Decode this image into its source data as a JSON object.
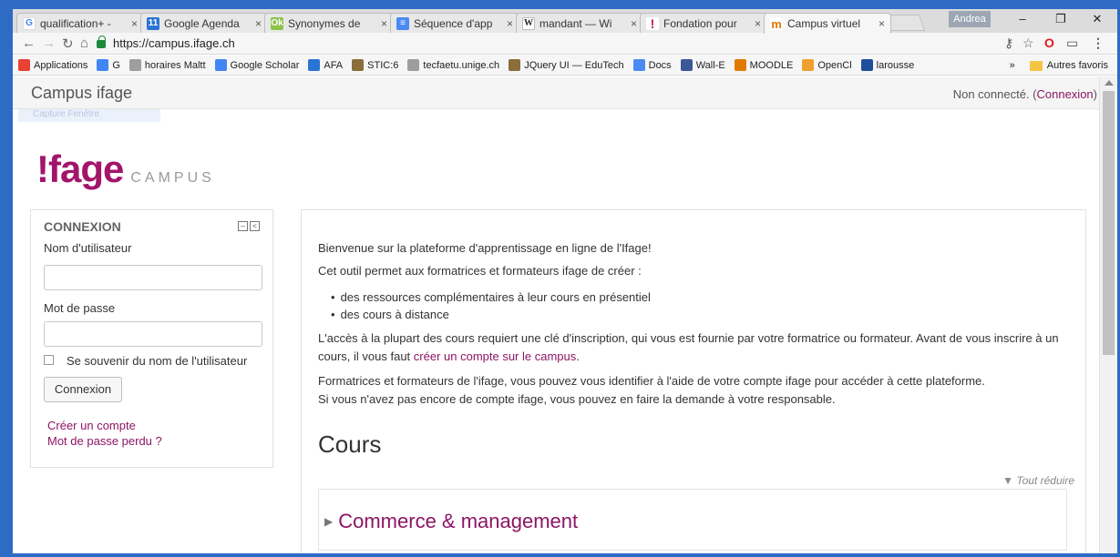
{
  "browser": {
    "tabs": [
      {
        "title": "qualification+ -",
        "fav": "G",
        "color": "#ffffff",
        "fg": "#4285f4"
      },
      {
        "title": "Google Agenda",
        "fav": "11",
        "color": "#2a74d5",
        "fg": "#ffffff"
      },
      {
        "title": "Synonymes de",
        "fav": "Ok",
        "color": "#8bc34a",
        "fg": "#ffffff"
      },
      {
        "title": "Séquence d'app",
        "fav": "≡",
        "color": "#4a8af4",
        "fg": "#ffffff"
      },
      {
        "title": "mandant — Wi",
        "fav": "W",
        "color": "#ffffff",
        "fg": "#222222"
      },
      {
        "title": "Fondation pour",
        "fav": "!",
        "color": "#ffffff",
        "fg": "#c2185b"
      },
      {
        "title": "Campus virtuel",
        "fav": "m",
        "color": "#ffffff",
        "fg": "#e07b00"
      }
    ],
    "profile": "Andrea",
    "url": "https://campus.ifage.ch",
    "bookmarks": [
      {
        "label": "Applications",
        "icon": "apps-icon",
        "color": "#e94235"
      },
      {
        "label": "G",
        "icon": "google-icon",
        "color": "#4285f4"
      },
      {
        "label": "horaires Maltt",
        "icon": "page-icon",
        "color": "#9e9e9e"
      },
      {
        "label": "Google Scholar",
        "icon": "scholar-icon",
        "color": "#4285f4"
      },
      {
        "label": "AFA",
        "icon": "calendar-icon",
        "color": "#2a74d5"
      },
      {
        "label": "STIC:6",
        "icon": "gnu-icon",
        "color": "#8a6d3b"
      },
      {
        "label": "tecfaetu.unige.ch",
        "icon": "page-icon",
        "color": "#9e9e9e"
      },
      {
        "label": "JQuery UI — EduTech",
        "icon": "gnu-icon",
        "color": "#8a6d3b"
      },
      {
        "label": "Docs",
        "icon": "docs-icon",
        "color": "#4a8af4"
      },
      {
        "label": "Wall-E",
        "icon": "facebook-icon",
        "color": "#3b5998"
      },
      {
        "label": "MOODLE",
        "icon": "moodle-icon",
        "color": "#e07b00"
      },
      {
        "label": "OpenCl",
        "icon": "opencl-icon",
        "color": "#f0a030"
      },
      {
        "label": "larousse",
        "icon": "larousse-icon",
        "color": "#1f4e9c"
      }
    ],
    "more_bookmarks": "»",
    "other_bookmarks": "Autres favoris"
  },
  "page": {
    "site_name": "Campus ifage",
    "ghost_tooltip": "Capture Fenêtre",
    "login_status": "Non connecté. (",
    "login_link": "Connexion",
    "login_status_end": ")",
    "logo_main": "!fage",
    "logo_sub": "CAMPUS",
    "login_block": {
      "title": "CONNEXION",
      "username_label": "Nom d'utilisateur",
      "password_label": "Mot de passe",
      "remember_label": "Se souvenir du nom de l'utilisateur",
      "submit": "Connexion",
      "create_account": "Créer un compte",
      "lost_password": "Mot de passe perdu ?"
    },
    "main": {
      "welcome": "Bienvenue sur la plateforme d'apprentissage en ligne de l'Ifage!",
      "intro": "Cet outil permet aux formatrices et formateurs ifage de créer :",
      "bullets": [
        "des ressources complémentaires à leur cours en présentiel",
        "des cours à distance"
      ],
      "access_text": "L'accès à la plupart des cours requiert une clé d'inscription, qui vous est fournie par votre formatrice ou formateur. Avant de vous inscrire à un cours, il vous faut",
      "access_link": "créer un compte sur le campus",
      "access_end": ".",
      "trainers_line1": "Formatrices et formateurs de l'ifage, vous pouvez vous identifier à l'aide de votre compte ifage pour accéder à cette plateforme.",
      "trainers_line2": "Si vous n'avez pas encore de compte ifage, vous pouvez en faire la demande à votre responsable.",
      "courses_title": "Cours",
      "collapse_all": "Tout réduire",
      "category": "Commerce & management"
    }
  },
  "colors": {
    "accent": "#8c1565",
    "logo": "#a3146b",
    "frame": "#2d6bc4"
  }
}
